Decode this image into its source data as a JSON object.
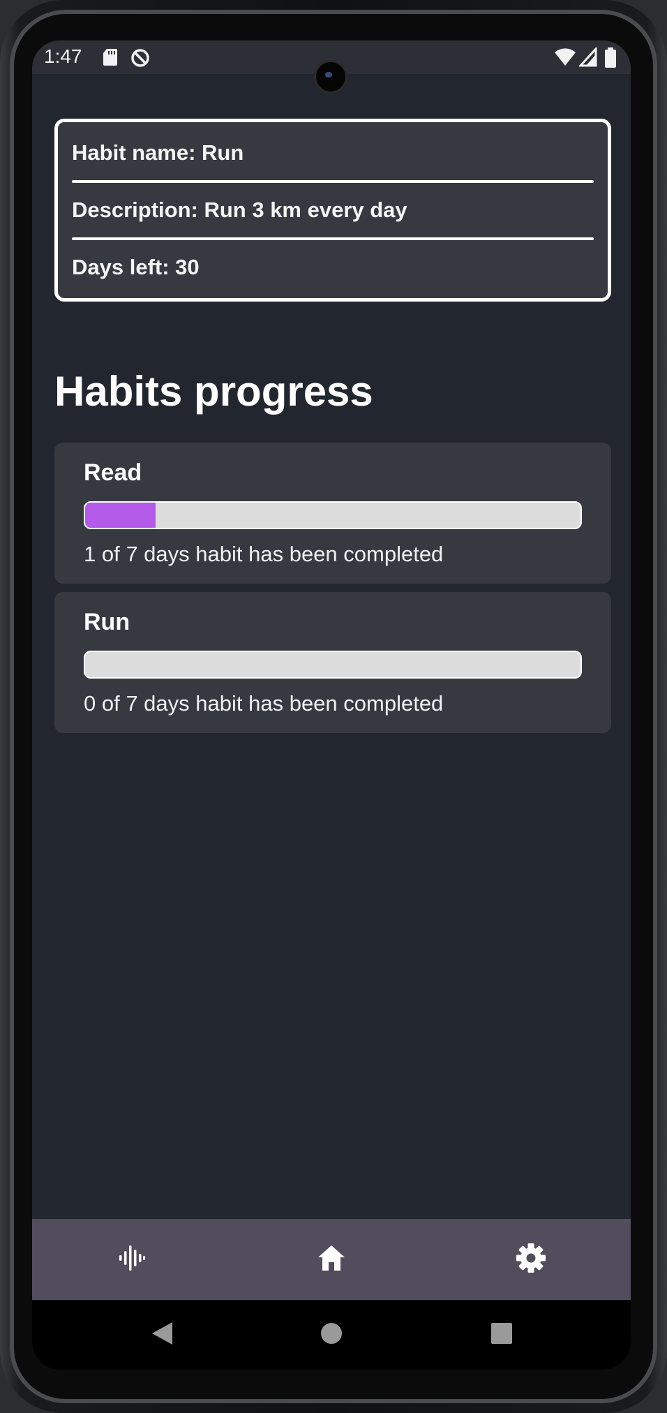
{
  "status_bar": {
    "time": "1:47",
    "icons": [
      "sd-card-icon",
      "data-saver-icon",
      "wifi-icon",
      "signal-icon",
      "battery-icon"
    ]
  },
  "habit_details": {
    "name_line": "Habit name: Run",
    "description_line": "Description: Run 3 km every day",
    "days_left_line": "Days left: 30"
  },
  "progress_section": {
    "title": "Habits progress",
    "habits": [
      {
        "name": "Read",
        "completed_days": 1,
        "total_days": 7,
        "status": "1 of 7 days habit has been completed"
      },
      {
        "name": "Run",
        "completed_days": 0,
        "total_days": 7,
        "status": "0 of 7 days habit has been completed"
      }
    ]
  },
  "bottom_nav": {
    "items": [
      "sound-wave-icon",
      "home-icon",
      "gear-icon"
    ]
  },
  "system_nav": {
    "items": [
      "back-icon",
      "home-circle-icon",
      "recents-icon"
    ]
  },
  "colors": {
    "background": "#22262e",
    "card": "#363a40",
    "progress_fill": "#b35ae8",
    "progress_track": "#dcdcdc",
    "bottom_nav": "#514d5c"
  }
}
